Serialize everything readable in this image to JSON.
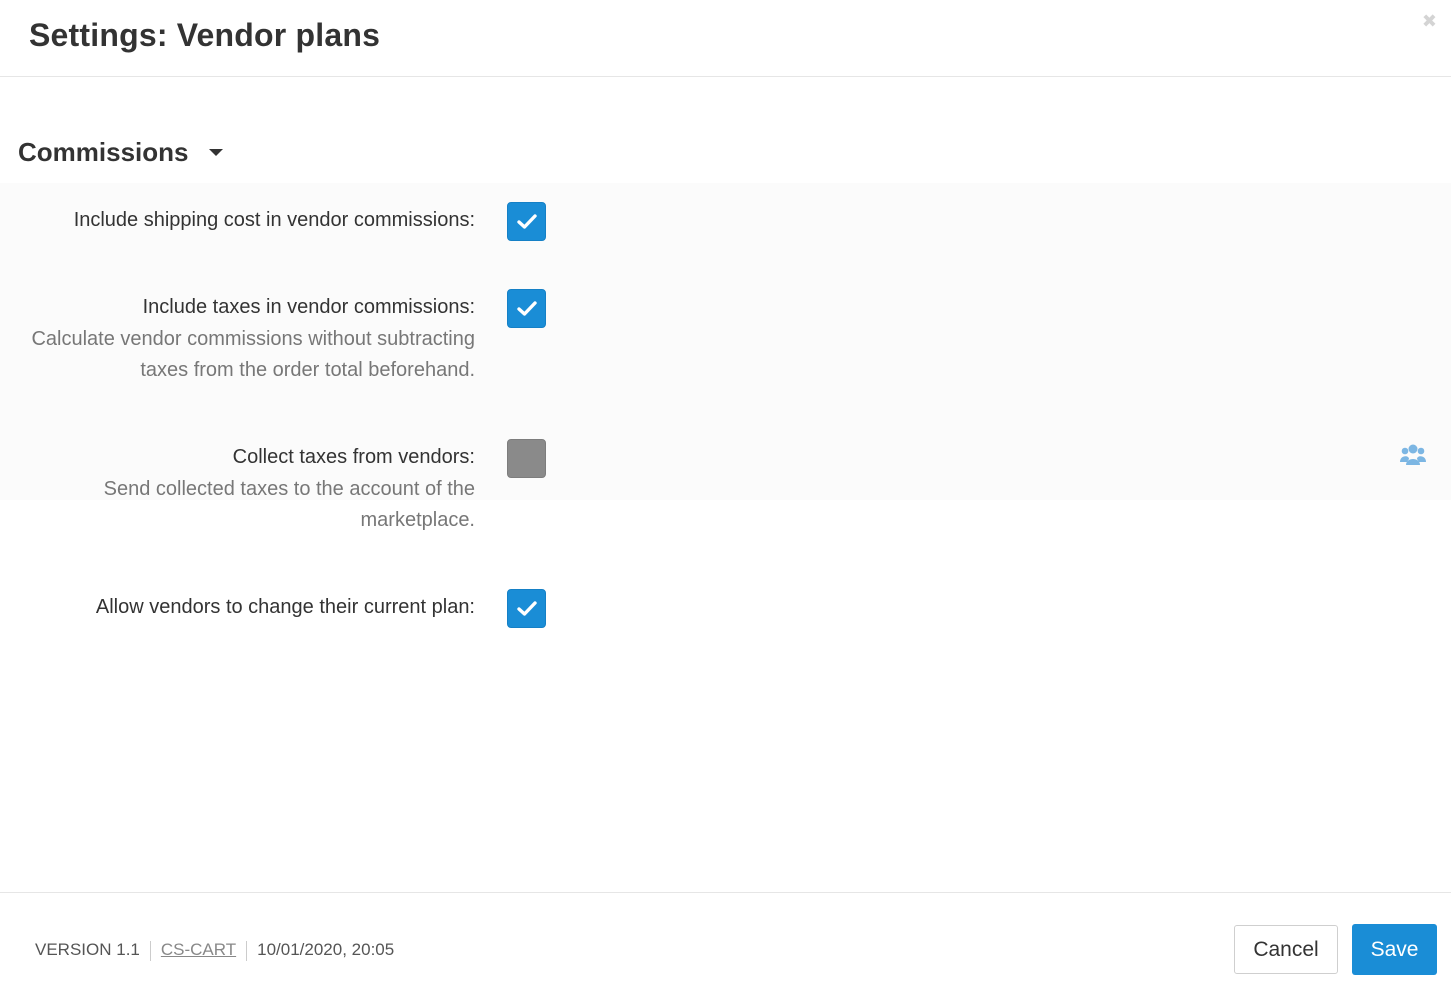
{
  "dialog": {
    "title": "Settings: Vendor plans",
    "close_icon": "close-icon"
  },
  "section": {
    "title": "Commissions",
    "caret_icon": "caret-down-icon"
  },
  "settings": [
    {
      "label": "Include shipping cost in vendor commissions:",
      "help": "",
      "checked": true
    },
    {
      "label": "Include taxes in vendor commissions:",
      "help": "Calculate vendor commissions without subtracting taxes from the order total beforehand.",
      "checked": true
    },
    {
      "label": "Collect taxes from vendors:",
      "help": "Send collected taxes to the account of the marketplace.",
      "checked": false,
      "side_icon": "users-icon"
    },
    {
      "label": "Allow vendors to change their current plan:",
      "help": "",
      "checked": true
    }
  ],
  "footer": {
    "version": "VERSION 1.1",
    "brand": "CS-CART",
    "timestamp": "10/01/2020, 20:05",
    "cancel_label": "Cancel",
    "save_label": "Save"
  },
  "colors": {
    "accent": "#1a8dd6",
    "unchecked": "#8a8a8a",
    "text": "#333333",
    "muted": "#777777"
  }
}
